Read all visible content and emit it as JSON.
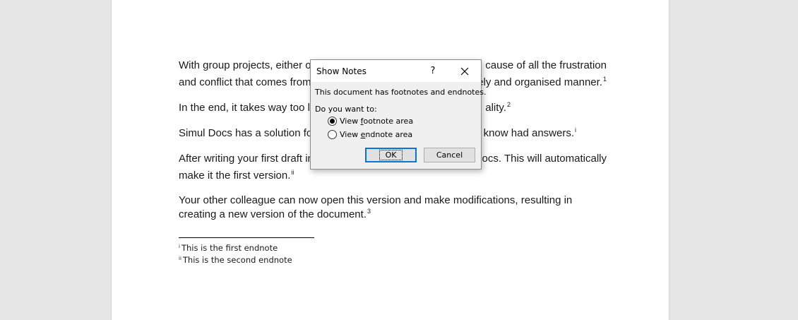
{
  "document": {
    "paragraphs": [
      {
        "lines": [
          "With group projects, either o",
          "cause of all the frustration"
        ],
        "sup": ""
      },
      {
        "lines": [
          "and conflict that comes from g",
          "ely and organised manner."
        ],
        "sup": "1"
      },
      {
        "lines": [
          "In the end, it takes way too lo",
          "ality."
        ],
        "sup": "2"
      },
      {
        "lines": [
          "Simul Docs has a solution fo",
          "know had answers."
        ],
        "sup": "i"
      },
      {
        "lines": [
          "After writing your first draft in",
          "ocs. This will automatically"
        ],
        "sup": ""
      },
      {
        "lines": [
          "make it the first version."
        ],
        "sup": "ii"
      },
      {
        "lines": [
          "Your other colleague can now open this version and make modifications, resulting in"
        ],
        "sup": ""
      },
      {
        "lines": [
          "creating a new version of the document."
        ],
        "sup": "3"
      }
    ],
    "endnotes": [
      {
        "marker": "i",
        "text": "This is the first endnote"
      },
      {
        "marker": "ii",
        "text": "This is the second endnote"
      }
    ]
  },
  "dialog": {
    "title": "Show Notes",
    "help": "?",
    "message": "This document has footnotes and endnotes.",
    "question": "Do you want to:",
    "options": [
      {
        "pre": "View ",
        "accel": "f",
        "post": "ootnote area",
        "checked": true
      },
      {
        "pre": "View ",
        "accel": "e",
        "post": "ndnote area",
        "checked": false
      }
    ],
    "ok_label": "OK",
    "cancel_label": "Cancel"
  },
  "colors": {
    "background": "#e6e6e6",
    "page": "#ffffff",
    "dialog": "#f0f0f0",
    "default_button_border": "#0078d7"
  }
}
